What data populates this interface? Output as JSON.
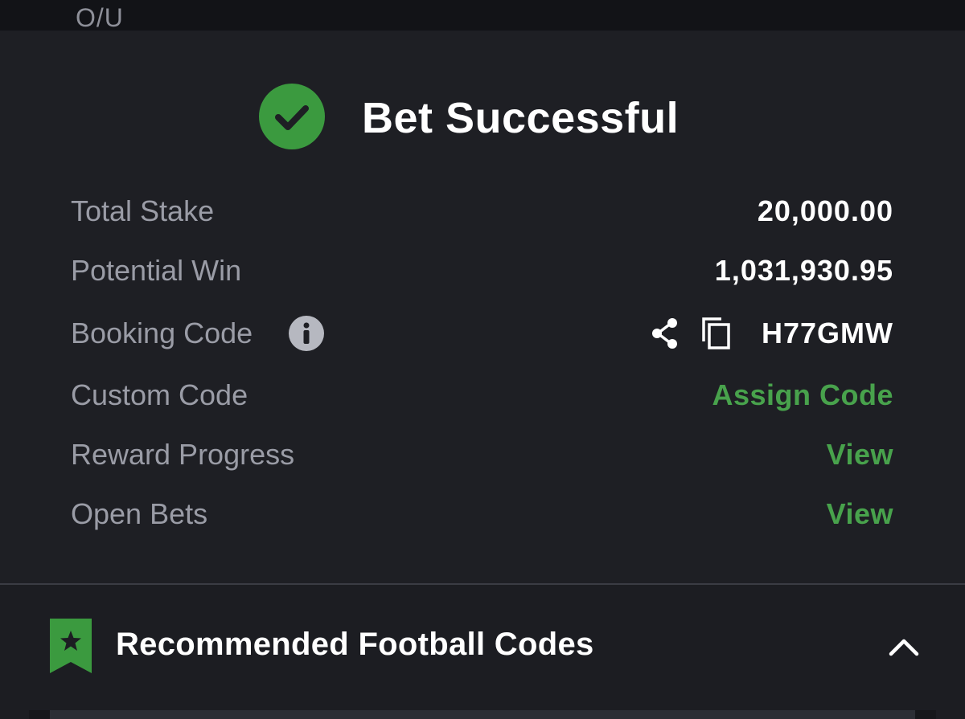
{
  "top_bar": {
    "label": "O/U"
  },
  "confirmation": {
    "title": "Bet Successful"
  },
  "details": {
    "total_stake": {
      "label": "Total Stake",
      "value": "20,000.00"
    },
    "potential_win": {
      "label": "Potential Win",
      "value": "1,031,930.95"
    },
    "booking_code": {
      "label": "Booking Code",
      "value": "H77GMW"
    },
    "custom_code": {
      "label": "Custom Code",
      "action": "Assign Code"
    },
    "reward_progress": {
      "label": "Reward Progress",
      "action": "View"
    },
    "open_bets": {
      "label": "Open Bets",
      "action": "View"
    }
  },
  "recommended": {
    "title": "Recommended Football Codes"
  },
  "icons": {
    "success": "check-circle-icon",
    "info": "info-icon",
    "share": "share-icon",
    "copy": "copy-icon",
    "bookmark": "bookmark-star-icon",
    "collapse": "chevron-up-icon"
  },
  "colors": {
    "background": "#1e1f24",
    "accent_green": "#48a24c",
    "label_gray": "#9a9ca6",
    "text_white": "#ffffff"
  }
}
